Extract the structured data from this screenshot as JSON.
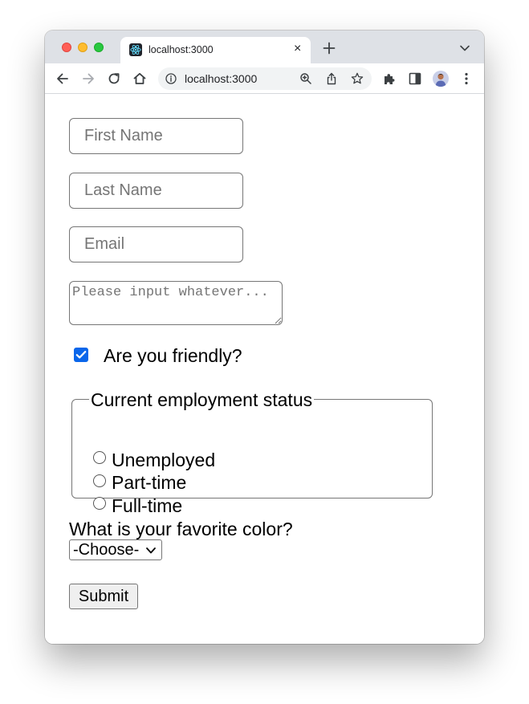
{
  "tab": {
    "title": "localhost:3000",
    "close": "×"
  },
  "toolbar": {
    "url": "localhost:3000"
  },
  "form": {
    "first_name_placeholder": "First Name",
    "last_name_placeholder": "Last Name",
    "email_placeholder": "Email",
    "textarea_placeholder": "Please input whatever...",
    "friendly_label": "Are you friendly?",
    "friendly_checked": true,
    "employment_legend": "Current employment status",
    "employment_options": [
      "Unemployed",
      "Part-time",
      "Full-time"
    ],
    "color_question": "What is your favorite color?",
    "color_selected": "-Choose-",
    "submit_label": "Submit"
  },
  "colors": {
    "accent": "#0a66ea",
    "tabstrip": "#dee1e6",
    "traffic_red": "#ff5f57",
    "traffic_yellow": "#febc2e",
    "traffic_green": "#28c840"
  }
}
